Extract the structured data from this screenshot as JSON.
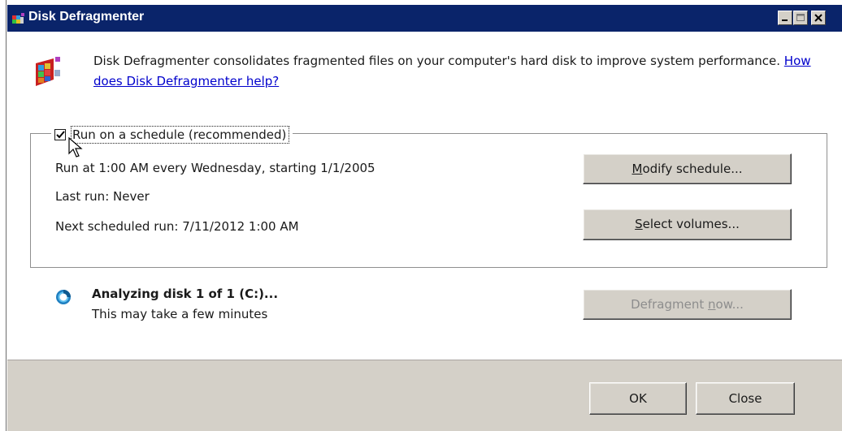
{
  "window": {
    "title": "Disk Defragmenter"
  },
  "titlebar": {
    "buttons": [
      "minimize-icon",
      "maximize-icon",
      "close-icon"
    ]
  },
  "intro": {
    "text": "Disk Defragmenter consolidates fragmented files on your computer's hard disk to improve system performance.",
    "link": "How does Disk Defragmenter help?"
  },
  "schedule": {
    "checkbox_label": "Run on a schedule (recommended)",
    "checked": true,
    "run_at": "Run at 1:00 AM every Wednesday, starting 1/1/2005",
    "last_run": "Last run: Never",
    "next_run": "Next scheduled run: 7/11/2012 1:00 AM",
    "modify_button": {
      "accel": "M",
      "rest": "odify schedule..."
    },
    "select_button": {
      "accel": "S",
      "rest": "elect volumes..."
    }
  },
  "status": {
    "title": "Analyzing disk 1 of 1 (C:)...",
    "subtitle": "This may take a few minutes",
    "defrag_button": {
      "before": "Defragment ",
      "accel": "n",
      "after": "ow..."
    }
  },
  "footer": {
    "ok_label": "OK",
    "close_label": "Close"
  },
  "colors": {
    "titlebar": "#0a246a",
    "button_face": "#d4d0c8",
    "link": "#0000cc",
    "disabled_text": "#8d8d8d"
  }
}
